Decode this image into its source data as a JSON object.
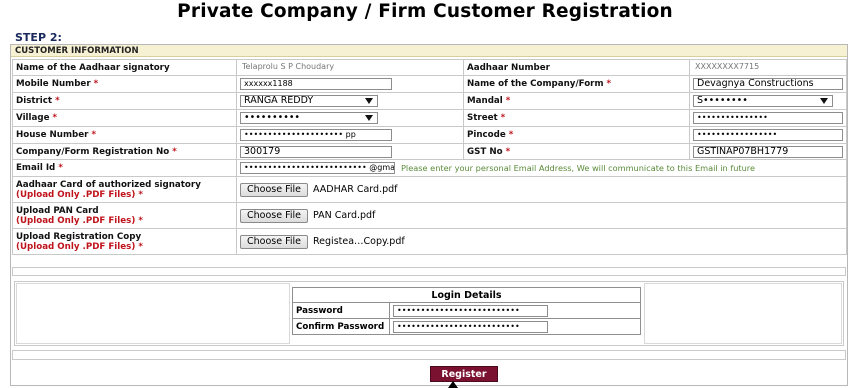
{
  "header": {
    "title": "Private Company / Firm Customer Registration",
    "step": "STEP 2:"
  },
  "section": {
    "title": "CUSTOMER INFORMATION"
  },
  "fields": {
    "aadhaar_signatory": {
      "label": "Name of the Aadhaar signatory",
      "value": "Telaprolu S P Choudary"
    },
    "aadhaar_number": {
      "label": "Aadhaar Number",
      "value": "XXXXXXXX7715"
    },
    "mobile": {
      "label": "Mobile Number",
      "value": "xxxxxx1188"
    },
    "company_name": {
      "label": "Name of the Company/Form",
      "value": "Devagnya Constructions"
    },
    "district": {
      "label": "District",
      "value": "RANGA REDDY"
    },
    "mandal": {
      "label": "Mandal",
      "value": "S••••••••"
    },
    "village": {
      "label": "Village",
      "value": "••••••••••"
    },
    "street": {
      "label": "Street",
      "value": "•••••••••••••••"
    },
    "house_number": {
      "label": "House Number",
      "value": "•••••••••••••••••••••",
      "suffix": "pp"
    },
    "pincode": {
      "label": "Pincode",
      "value": "•••••••••••••••••"
    },
    "registration_no": {
      "label": "Company/Form Registration No",
      "value": "300179"
    },
    "gst_no": {
      "label": "GST No",
      "value": "GSTINAP07BH1779"
    },
    "email": {
      "label": "Email Id",
      "value": "••••••••••••••••••••••••••",
      "suffix": "@gma",
      "hint": "Please enter your personal Email Address, We will communicate to this Email in future"
    }
  },
  "uploads": {
    "aadhaar": {
      "label": "Aadhaar Card of authorized signatory",
      "note": "(Upload Only .PDF Files)",
      "button": "Choose File",
      "file": "AADHAR Card.pdf"
    },
    "pan": {
      "label": "Upload PAN Card",
      "note": "(Upload Only .PDF Files)",
      "button": "Choose File",
      "file": "PAN Card.pdf"
    },
    "registration": {
      "label": "Upload Registration Copy",
      "note": "(Upload Only .PDF Files)",
      "button": "Choose File",
      "file": "Registea…Copy.pdf"
    }
  },
  "login": {
    "title": "Login Details",
    "password_label": "Password",
    "password_value": "••••••••••••••••••••••••••",
    "confirm_label": "Confirm Password",
    "confirm_value": "••••••••••••••••••••••••••"
  },
  "actions": {
    "register": "Register"
  },
  "required_mark": "*"
}
